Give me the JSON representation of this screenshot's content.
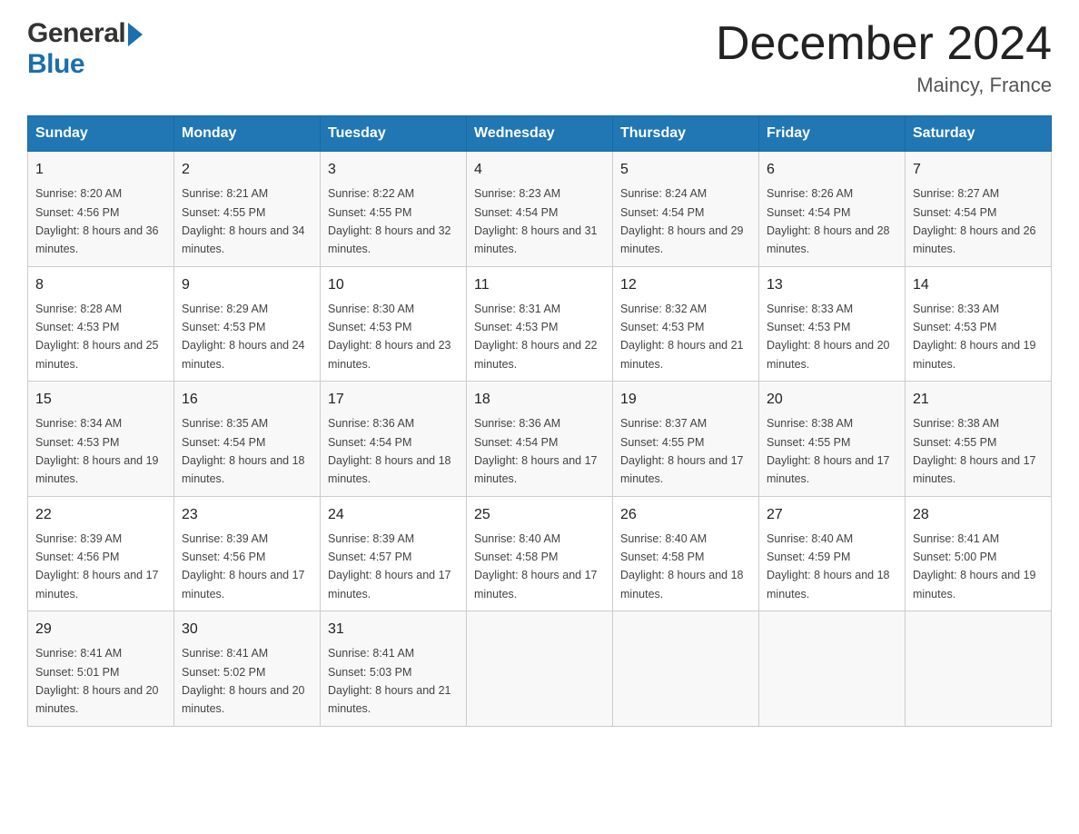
{
  "header": {
    "logo_general": "General",
    "logo_blue": "Blue",
    "month_title": "December 2024",
    "location": "Maincy, France"
  },
  "weekdays": [
    "Sunday",
    "Monday",
    "Tuesday",
    "Wednesday",
    "Thursday",
    "Friday",
    "Saturday"
  ],
  "weeks": [
    [
      {
        "day": "1",
        "sunrise": "8:20 AM",
        "sunset": "4:56 PM",
        "daylight": "8 hours and 36 minutes."
      },
      {
        "day": "2",
        "sunrise": "8:21 AM",
        "sunset": "4:55 PM",
        "daylight": "8 hours and 34 minutes."
      },
      {
        "day": "3",
        "sunrise": "8:22 AM",
        "sunset": "4:55 PM",
        "daylight": "8 hours and 32 minutes."
      },
      {
        "day": "4",
        "sunrise": "8:23 AM",
        "sunset": "4:54 PM",
        "daylight": "8 hours and 31 minutes."
      },
      {
        "day": "5",
        "sunrise": "8:24 AM",
        "sunset": "4:54 PM",
        "daylight": "8 hours and 29 minutes."
      },
      {
        "day": "6",
        "sunrise": "8:26 AM",
        "sunset": "4:54 PM",
        "daylight": "8 hours and 28 minutes."
      },
      {
        "day": "7",
        "sunrise": "8:27 AM",
        "sunset": "4:54 PM",
        "daylight": "8 hours and 26 minutes."
      }
    ],
    [
      {
        "day": "8",
        "sunrise": "8:28 AM",
        "sunset": "4:53 PM",
        "daylight": "8 hours and 25 minutes."
      },
      {
        "day": "9",
        "sunrise": "8:29 AM",
        "sunset": "4:53 PM",
        "daylight": "8 hours and 24 minutes."
      },
      {
        "day": "10",
        "sunrise": "8:30 AM",
        "sunset": "4:53 PM",
        "daylight": "8 hours and 23 minutes."
      },
      {
        "day": "11",
        "sunrise": "8:31 AM",
        "sunset": "4:53 PM",
        "daylight": "8 hours and 22 minutes."
      },
      {
        "day": "12",
        "sunrise": "8:32 AM",
        "sunset": "4:53 PM",
        "daylight": "8 hours and 21 minutes."
      },
      {
        "day": "13",
        "sunrise": "8:33 AM",
        "sunset": "4:53 PM",
        "daylight": "8 hours and 20 minutes."
      },
      {
        "day": "14",
        "sunrise": "8:33 AM",
        "sunset": "4:53 PM",
        "daylight": "8 hours and 19 minutes."
      }
    ],
    [
      {
        "day": "15",
        "sunrise": "8:34 AM",
        "sunset": "4:53 PM",
        "daylight": "8 hours and 19 minutes."
      },
      {
        "day": "16",
        "sunrise": "8:35 AM",
        "sunset": "4:54 PM",
        "daylight": "8 hours and 18 minutes."
      },
      {
        "day": "17",
        "sunrise": "8:36 AM",
        "sunset": "4:54 PM",
        "daylight": "8 hours and 18 minutes."
      },
      {
        "day": "18",
        "sunrise": "8:36 AM",
        "sunset": "4:54 PM",
        "daylight": "8 hours and 17 minutes."
      },
      {
        "day": "19",
        "sunrise": "8:37 AM",
        "sunset": "4:55 PM",
        "daylight": "8 hours and 17 minutes."
      },
      {
        "day": "20",
        "sunrise": "8:38 AM",
        "sunset": "4:55 PM",
        "daylight": "8 hours and 17 minutes."
      },
      {
        "day": "21",
        "sunrise": "8:38 AM",
        "sunset": "4:55 PM",
        "daylight": "8 hours and 17 minutes."
      }
    ],
    [
      {
        "day": "22",
        "sunrise": "8:39 AM",
        "sunset": "4:56 PM",
        "daylight": "8 hours and 17 minutes."
      },
      {
        "day": "23",
        "sunrise": "8:39 AM",
        "sunset": "4:56 PM",
        "daylight": "8 hours and 17 minutes."
      },
      {
        "day": "24",
        "sunrise": "8:39 AM",
        "sunset": "4:57 PM",
        "daylight": "8 hours and 17 minutes."
      },
      {
        "day": "25",
        "sunrise": "8:40 AM",
        "sunset": "4:58 PM",
        "daylight": "8 hours and 17 minutes."
      },
      {
        "day": "26",
        "sunrise": "8:40 AM",
        "sunset": "4:58 PM",
        "daylight": "8 hours and 18 minutes."
      },
      {
        "day": "27",
        "sunrise": "8:40 AM",
        "sunset": "4:59 PM",
        "daylight": "8 hours and 18 minutes."
      },
      {
        "day": "28",
        "sunrise": "8:41 AM",
        "sunset": "5:00 PM",
        "daylight": "8 hours and 19 minutes."
      }
    ],
    [
      {
        "day": "29",
        "sunrise": "8:41 AM",
        "sunset": "5:01 PM",
        "daylight": "8 hours and 20 minutes."
      },
      {
        "day": "30",
        "sunrise": "8:41 AM",
        "sunset": "5:02 PM",
        "daylight": "8 hours and 20 minutes."
      },
      {
        "day": "31",
        "sunrise": "8:41 AM",
        "sunset": "5:03 PM",
        "daylight": "8 hours and 21 minutes."
      },
      null,
      null,
      null,
      null
    ]
  ]
}
